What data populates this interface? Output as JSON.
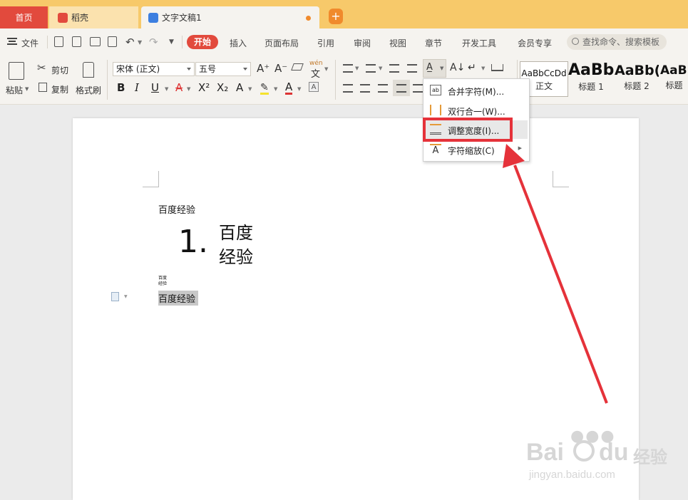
{
  "tabs": {
    "home": "首页",
    "daoke": "稻壳",
    "document": "文字文稿1"
  },
  "menu": {
    "file": "文件",
    "start": "开始",
    "items": [
      "插入",
      "页面布局",
      "引用",
      "审阅",
      "视图",
      "章节",
      "开发工具",
      "会员专享"
    ],
    "search_placeholder": "查找命令、搜索模板"
  },
  "ribbon": {
    "paste": "粘贴",
    "cut": "剪切",
    "copy": "复制",
    "format_painter": "格式刷",
    "font_name": "宋体 (正文)",
    "font_size": "五号",
    "styles": [
      {
        "sample": "AaBbCcDd",
        "name": "正文"
      },
      {
        "sample": "AaBb",
        "name": "标题 1"
      },
      {
        "sample": "AaBb(",
        "name": "标题 2"
      },
      {
        "sample": "AaBl",
        "name": "标题"
      }
    ]
  },
  "dropdown": {
    "merge_chars": "合并字符(M)...",
    "two_lines": "双行合一(W)...",
    "adjust_width": "调整宽度(I)...",
    "char_scale": "字符缩放(C)"
  },
  "document": {
    "line1": "百度经验",
    "list_number": "1.",
    "list_text_1": "百度",
    "list_text_2": "经验",
    "tiny_1": "百度",
    "tiny_2": "经验",
    "selected_text": "百度经验"
  },
  "watermark": {
    "brand": "Bai",
    "brand_cn": "经验",
    "url": "jingyan.baidu.com"
  },
  "colors": {
    "accent_red": "#e24a3d",
    "tabbar_orange": "#f7c96a",
    "highlight_red": "#e5323a"
  }
}
